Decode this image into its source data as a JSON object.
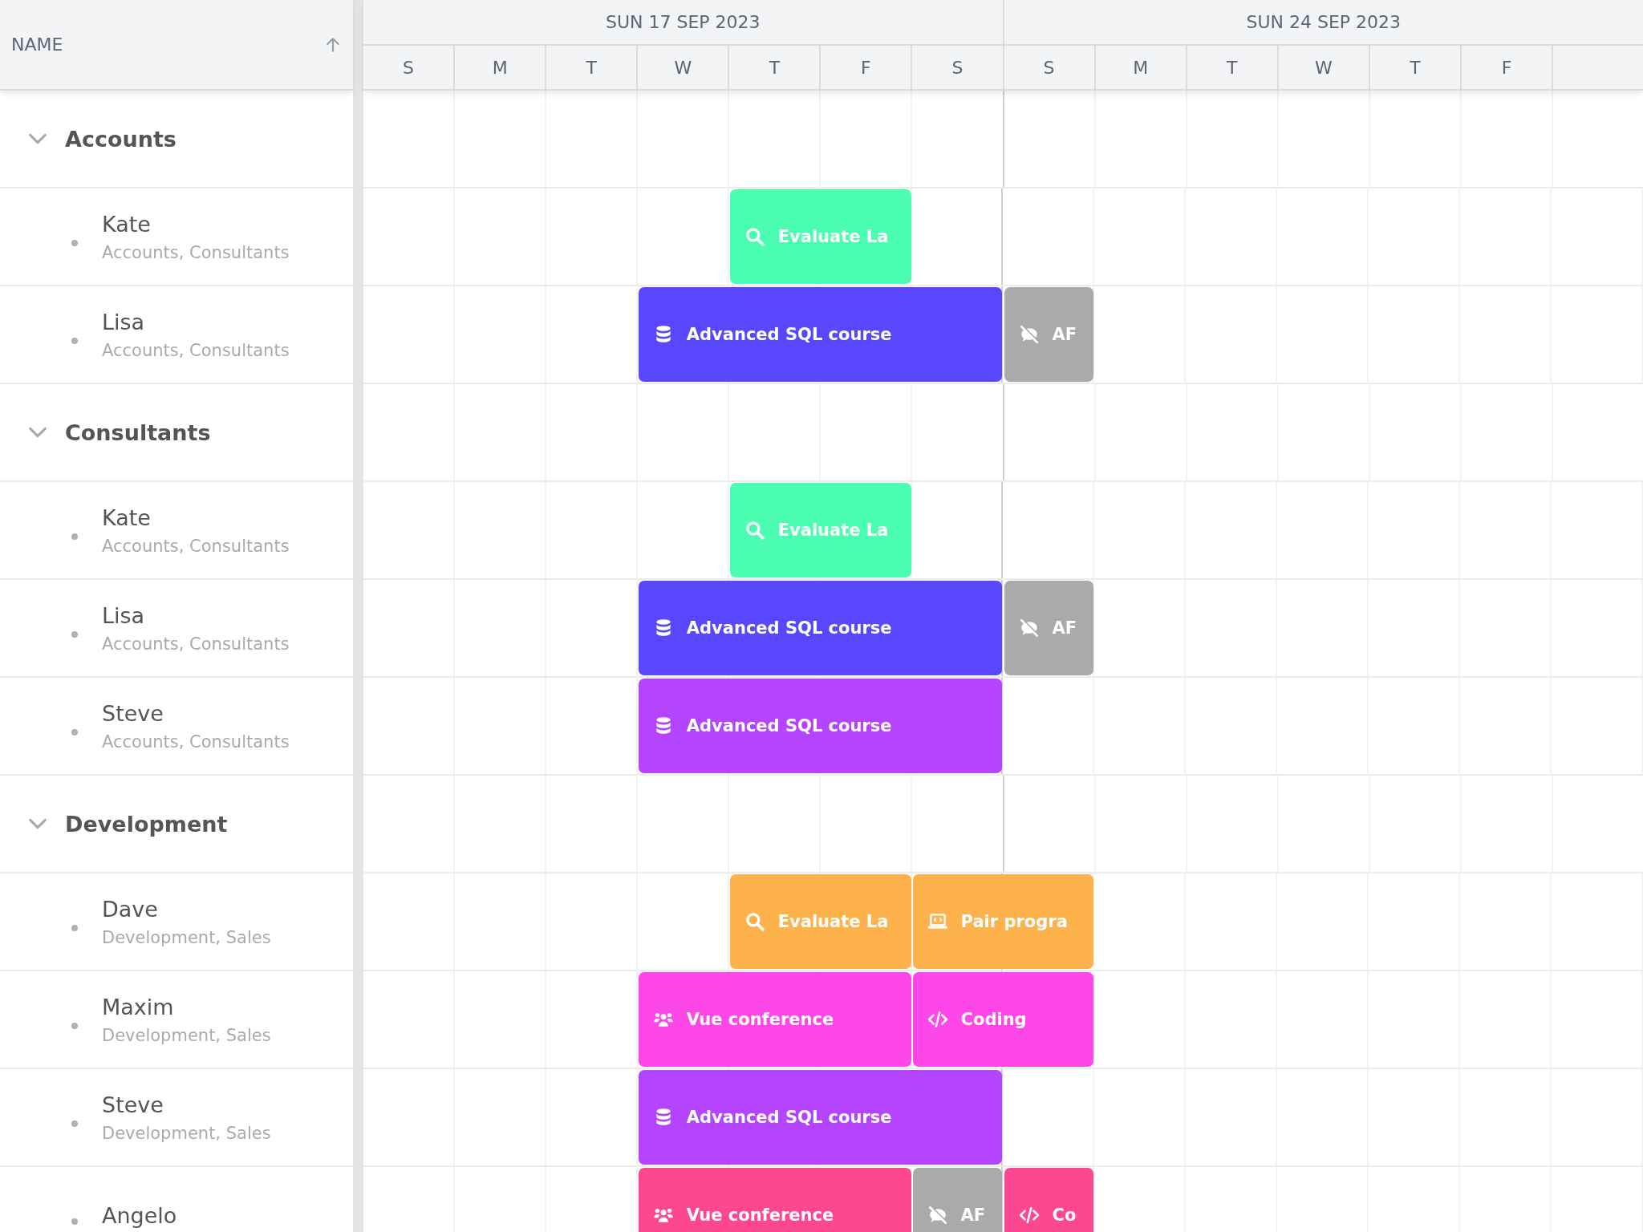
{
  "name_column": {
    "label": "NAME"
  },
  "weeks": [
    {
      "label": "SUN 17 SEP 2023"
    },
    {
      "label": "SUN 24 SEP 2023"
    }
  ],
  "days": [
    "S",
    "M",
    "T",
    "W",
    "T",
    "F",
    "S",
    "S",
    "M",
    "T",
    "W",
    "T",
    "F"
  ],
  "groups": [
    {
      "name": "Accounts",
      "expanded": true,
      "members": [
        {
          "name": "Kate",
          "teams": "Accounts, Consultants",
          "events": [
            {
              "kind": "search",
              "title": "Evaluate La",
              "color": "#4afdb1"
            }
          ]
        },
        {
          "name": "Lisa",
          "teams": "Accounts, Consultants",
          "events": [
            {
              "kind": "database",
              "title": "Advanced SQL course",
              "color": "#5847fd"
            },
            {
              "kind": "hidden",
              "title": "AF",
              "color": "#aaaaaa"
            }
          ]
        }
      ]
    },
    {
      "name": "Consultants",
      "expanded": true,
      "members": [
        {
          "name": "Kate",
          "teams": "Accounts, Consultants",
          "events": [
            {
              "kind": "search",
              "title": "Evaluate La",
              "color": "#4afdb1"
            }
          ]
        },
        {
          "name": "Lisa",
          "teams": "Accounts, Consultants",
          "events": [
            {
              "kind": "database",
              "title": "Advanced SQL course",
              "color": "#5847fd"
            },
            {
              "kind": "hidden",
              "title": "AF",
              "color": "#aaaaaa"
            }
          ]
        },
        {
          "name": "Steve",
          "teams": "Accounts, Consultants",
          "events": [
            {
              "kind": "database",
              "title": "Advanced SQL course",
              "color": "#b444fd"
            }
          ]
        }
      ]
    },
    {
      "name": "Development",
      "expanded": true,
      "members": [
        {
          "name": "Dave",
          "teams": "Development, Sales",
          "events": [
            {
              "kind": "search",
              "title": "Evaluate La",
              "color": "#fdb24b"
            },
            {
              "kind": "laptop",
              "title": "Pair progra",
              "color": "#fdb24b"
            }
          ]
        },
        {
          "name": "Maxim",
          "teams": "Development, Sales",
          "events": [
            {
              "kind": "people",
              "title": "Vue conference",
              "color": "#fd47e9"
            },
            {
              "kind": "code",
              "title": "Coding",
              "color": "#fd47e9"
            }
          ]
        },
        {
          "name": "Steve",
          "teams": "Development, Sales",
          "events": [
            {
              "kind": "database",
              "title": "Advanced SQL course",
              "color": "#b444fd"
            }
          ]
        },
        {
          "name": "Angelo",
          "events": [
            {
              "kind": "people",
              "title": "Vue conference",
              "color": "#fd4791"
            },
            {
              "kind": "hidden",
              "title": "AF",
              "color": "#aaaaaa"
            },
            {
              "kind": "code",
              "title": "Co",
              "color": "#fd4791"
            }
          ]
        }
      ]
    }
  ]
}
